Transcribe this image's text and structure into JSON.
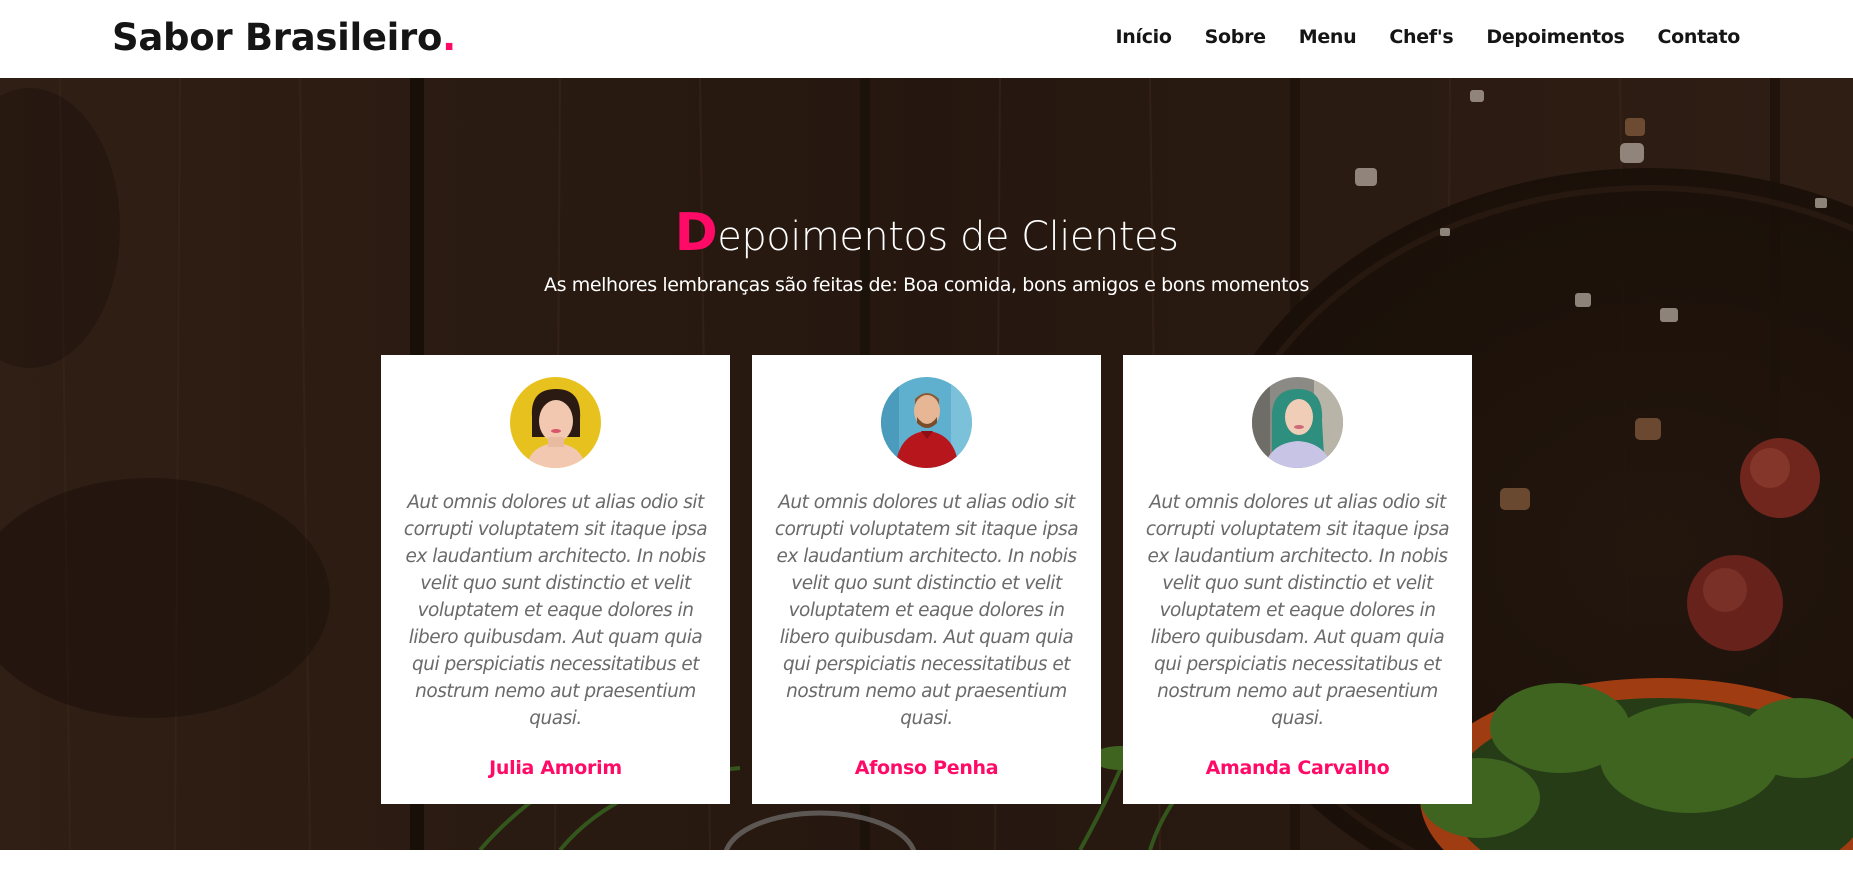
{
  "brand": {
    "name": "Sabor Brasileiro",
    "dot": ".",
    "accent_color": "#ff0a67"
  },
  "nav": {
    "items": [
      {
        "label": "Início"
      },
      {
        "label": "Sobre"
      },
      {
        "label": "Menu"
      },
      {
        "label": "Chef's"
      },
      {
        "label": "Depoimentos"
      },
      {
        "label": "Contato"
      }
    ]
  },
  "section": {
    "title_first_letter": "D",
    "title_rest": "epoimentos de Clientes",
    "subtitle": "As melhores lembranças são feitas de: Boa comida, bons amigos e bons momentos"
  },
  "testimonials": [
    {
      "quote": "Aut omnis dolores ut alias odio sit corrupti voluptatem sit itaque ipsa ex laudantium architecto. In nobis velit quo sunt distinctio et velit voluptatem et eaque dolores in libero quibusdam. Aut quam quia qui perspiciatis necessitatibus et nostrum nemo aut praesentium quasi.",
      "name": "Julia Amorim",
      "avatar_icon": "avatar-woman-yellow-background"
    },
    {
      "quote": "Aut omnis dolores ut alias odio sit corrupti voluptatem sit itaque ipsa ex laudantium architecto. In nobis velit quo sunt distinctio et velit voluptatem et eaque dolores in libero quibusdam. Aut quam quia qui perspiciatis necessitatibus et nostrum nemo aut praesentium quasi.",
      "name": "Afonso Penha",
      "avatar_icon": "avatar-man-red-shirt-blue-background"
    },
    {
      "quote": "Aut omnis dolores ut alias odio sit corrupti voluptatem sit itaque ipsa ex laudantium architecto. In nobis velit quo sunt distinctio et velit voluptatem et eaque dolores in libero quibusdam. Aut quam quia qui perspiciatis necessitatibus et nostrum nemo aut praesentium quasi.",
      "name": "Amanda Carvalho",
      "avatar_icon": "avatar-woman-green-hair"
    }
  ]
}
